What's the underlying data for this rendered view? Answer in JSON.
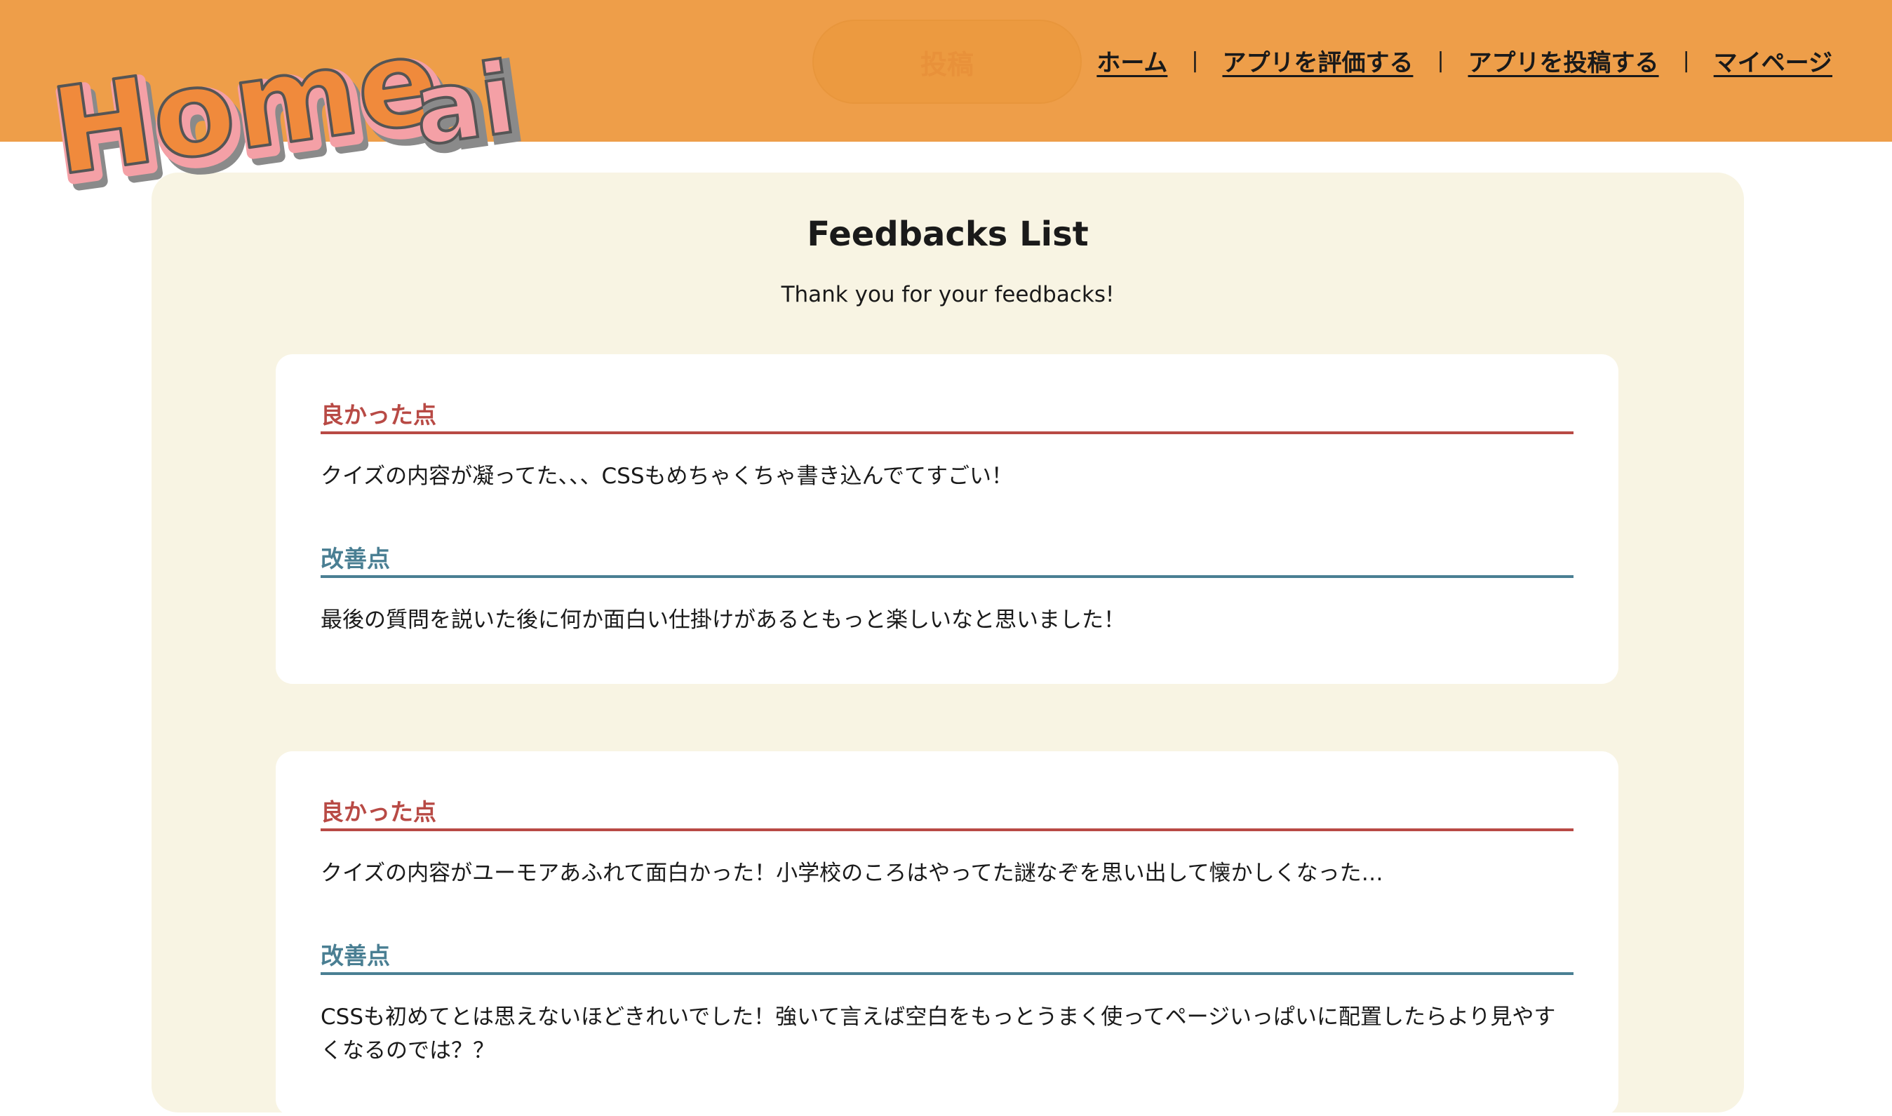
{
  "header": {
    "logo": {
      "text_main": "Home",
      "text_sub": "ai"
    },
    "post_button_label": "投稿",
    "nav": [
      {
        "label": "ホーム"
      },
      {
        "label": "アプリを評価する"
      },
      {
        "label": "アプリを投稿する"
      },
      {
        "label": "マイページ"
      }
    ],
    "nav_separator": "|"
  },
  "main": {
    "title": "Feedbacks List",
    "subtitle": "Thank you for your feedbacks!",
    "feedbacks": [
      {
        "good_label": "良かった点",
        "good_text": "クイズの内容が凝ってた、、、CSSもめちゃくちゃ書き込んでてすごい！",
        "improve_label": "改善点",
        "improve_text": "最後の質問を説いた後に何か面白い仕掛けがあるともっと楽しいなと思いました！"
      },
      {
        "good_label": "良かった点",
        "good_text": "クイズの内容がユーモアあふれて面白かった！小学校のころはやってた謎なぞを思い出して懐かしくなった…",
        "improve_label": "改善点",
        "improve_text": "CSSも初めてとは思えないほどきれいでした！強いて言えば空白をもっとうまく使ってページいっぱいに配置したらより見やすくなるのでは？？"
      }
    ]
  },
  "colors": {
    "header_bg": "#ee9e49",
    "panel_bg": "#f8f4e3",
    "good_accent": "#b84a45",
    "improve_accent": "#4a7f93",
    "logo_fill": "#f4a0a6",
    "logo_orange": "#f08a3c"
  }
}
